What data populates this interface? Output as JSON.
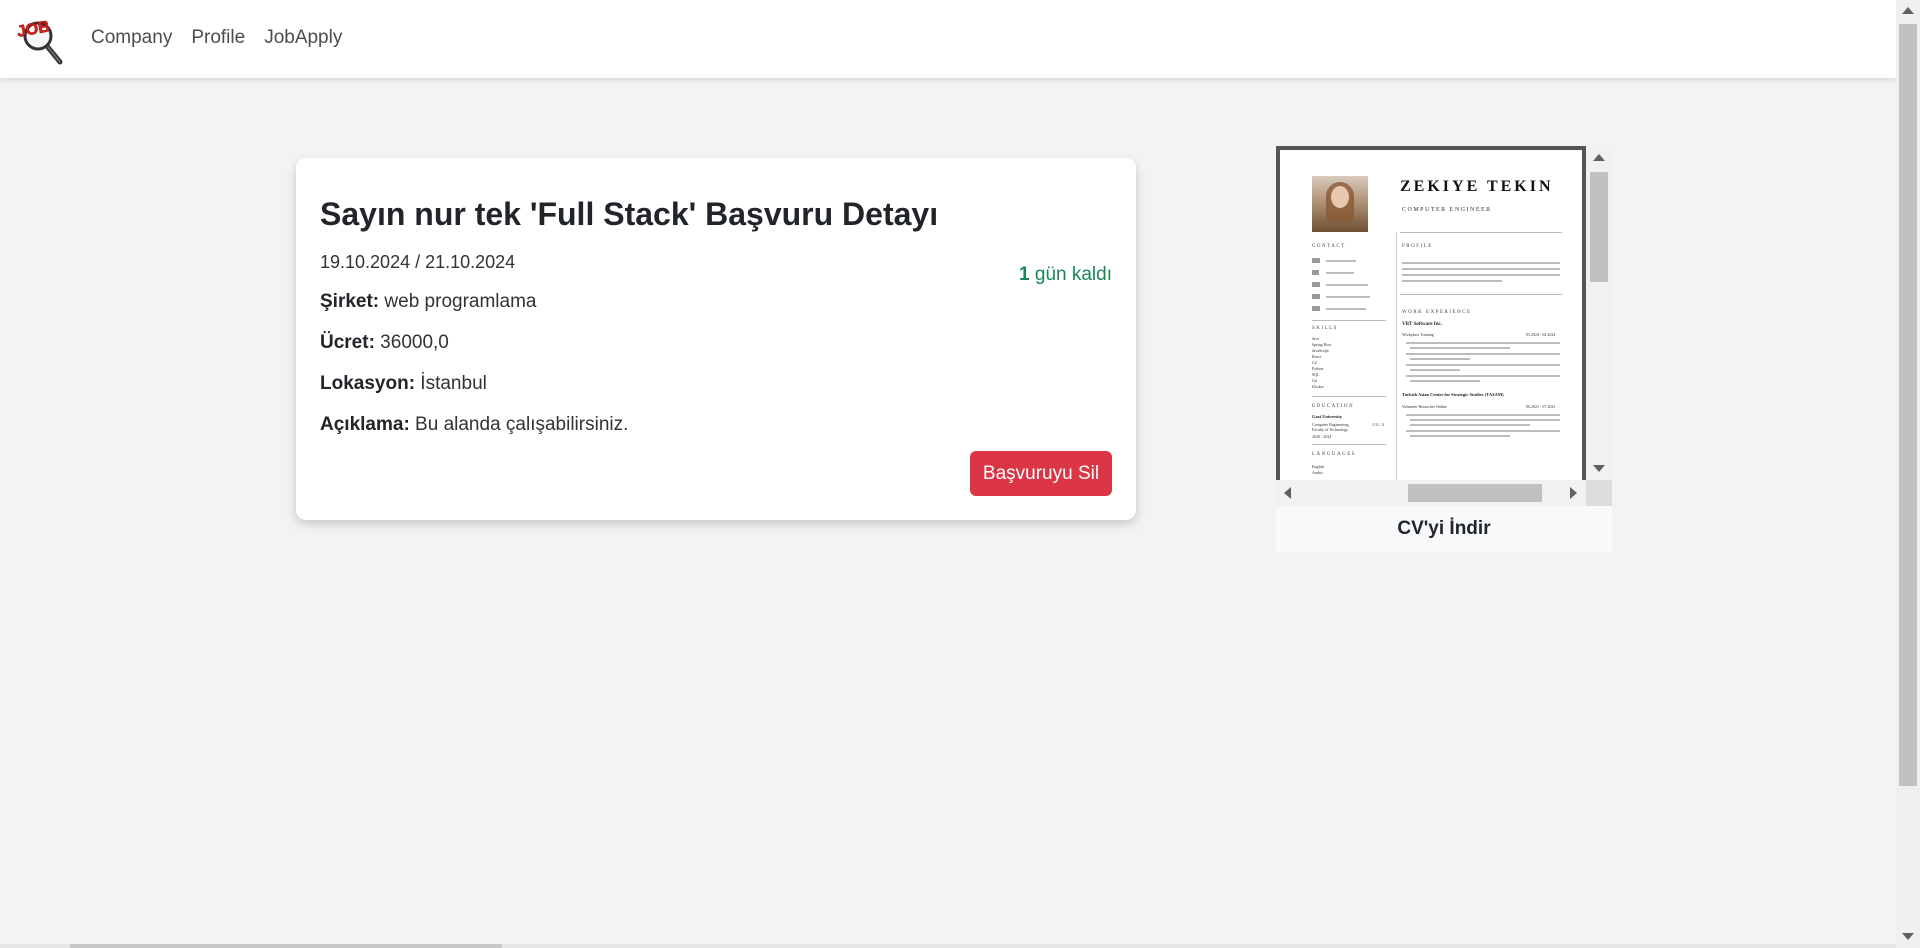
{
  "nav": {
    "logo_text": "JOB",
    "links": [
      "Company",
      "Profile",
      "JobApply"
    ]
  },
  "application": {
    "title": "Sayın nur tek 'Full Stack' Başvuru Detayı",
    "dates": "19.10.2024 / 21.10.2024",
    "days_left_number": "1",
    "days_left_text": " gün kaldı",
    "fields": [
      {
        "label": "Şirket:",
        "value": " web programlama"
      },
      {
        "label": "Ücret:",
        "value": " 36000,0"
      },
      {
        "label": "Lokasyon:",
        "value": " İstanbul"
      },
      {
        "label": "Açıklama:",
        "value": " Bu alanda çalışabilirsiniz."
      }
    ],
    "delete_label": "Başvuruyu Sil"
  },
  "cv": {
    "download_label": "CV'yi İndir",
    "name": "ZEKIYE TEKIN",
    "role": "COMPUTER ENGINEER",
    "contact_heading": "CONTACT",
    "skills_heading": "SKILLS",
    "education_heading": "EDUCATION",
    "languages_heading": "LANGUAGES",
    "profile_heading": "PROFILE",
    "work_heading": "WORK EXPERIENCE",
    "company1": "VBT Software Inc.",
    "company1_role": "Workplace Training",
    "company1_dates": "03.2024 - 04.2024",
    "company2": "Turkish Asian Center for Strategic Studies (TASAM)",
    "company2_role": "Volunteer Reseacher Online",
    "company2_dates": "06.2023 - 07.2023",
    "education_school": "Gazi University",
    "education_dept": "Computer Engineering,",
    "education_faculty": "Faculty of Technology",
    "education_years": "2020 - 2024",
    "education_gpa": "3.11 / 4",
    "skills": [
      "Java",
      "Spring Boot",
      "JavaScript",
      "React",
      "C#",
      "Python",
      "SQL",
      "Git",
      "Docker"
    ],
    "languages": [
      "English",
      "Arabic"
    ]
  },
  "colors": {
    "danger": "#dc3545",
    "success": "#198754",
    "background": "#f3f3f3"
  }
}
